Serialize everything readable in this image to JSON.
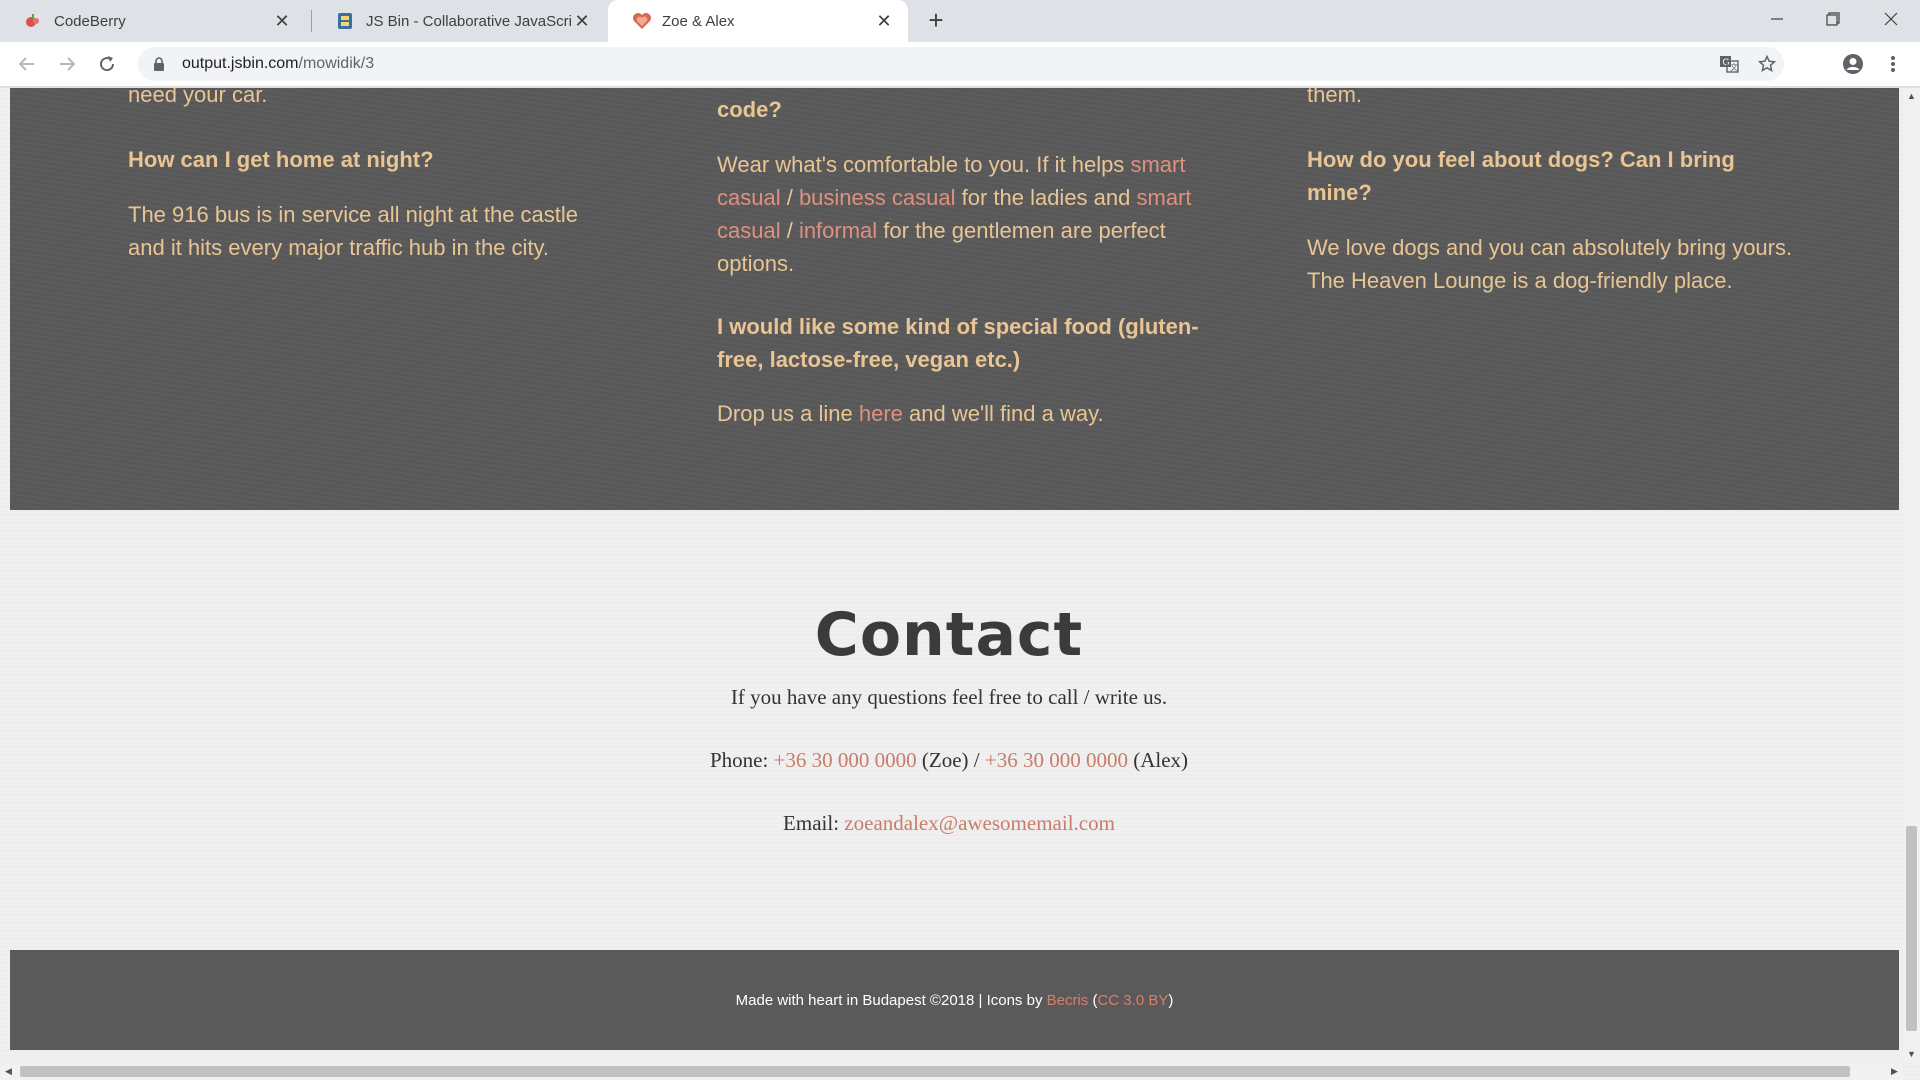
{
  "browser": {
    "tabs": [
      {
        "title": "CodeBerry",
        "icon": "codeberry-icon"
      },
      {
        "title": "JS Bin - Collaborative JavaScript Debugging",
        "icon": "jsbin-icon"
      },
      {
        "title": "Zoe & Alex",
        "icon": "heart-icon"
      }
    ],
    "active_tab": 2,
    "url_domain": "output.jsbin.com",
    "url_path": "/mowidik/3"
  },
  "faq": {
    "col1": {
      "partial": "need your car.",
      "q1": "How can I get home at night?",
      "a1": "The 916 bus is in service all night at the castle and it hits every major traffic hub in the city."
    },
    "col2": {
      "partial": "code?",
      "a_part1": "Wear what's comfortable to you. If it helps ",
      "link1": "smart casual",
      "sep1": " / ",
      "link2": "business casual",
      "a_part2": " for the ladies and ",
      "link3": "smart casual",
      "sep2": " / ",
      "link4": "informal",
      "a_part3": " for the gentlemen are perfect options.",
      "q2": "I would like some kind of special food (gluten-free, lactose-free, vegan etc.)",
      "a2_part1": "Drop us a line ",
      "a2_link": "here",
      "a2_part2": " and we'll find a way."
    },
    "col3": {
      "partial": "them.",
      "q1": "How do you feel about dogs? Can I bring mine?",
      "a1": "We love dogs and you can absolutely bring yours. The Heaven Lounge is a dog-friendly place."
    }
  },
  "contact": {
    "title": "Contact",
    "intro": "If you have any questions feel free to call / write us.",
    "phone_label": "Phone: ",
    "phone1": "+36 30 000 0000",
    "name1": " (Zoe) / ",
    "phone2": "+36 30 000 0000",
    "name2": " (Alex)",
    "email_label": "Email: ",
    "email": "zoeandalex@awesomemail.com"
  },
  "footer": {
    "text": "Made with heart in Budapest ©2018 | Icons by ",
    "link1": "Becris",
    "paren_open": " (",
    "link2": "CC 3.0 BY",
    "paren_close": ")"
  },
  "colors": {
    "faq_bg": "#5a5a5b",
    "faq_text": "#e9c594",
    "link": "#e0907d",
    "page_bg": "#f0f0f0"
  }
}
